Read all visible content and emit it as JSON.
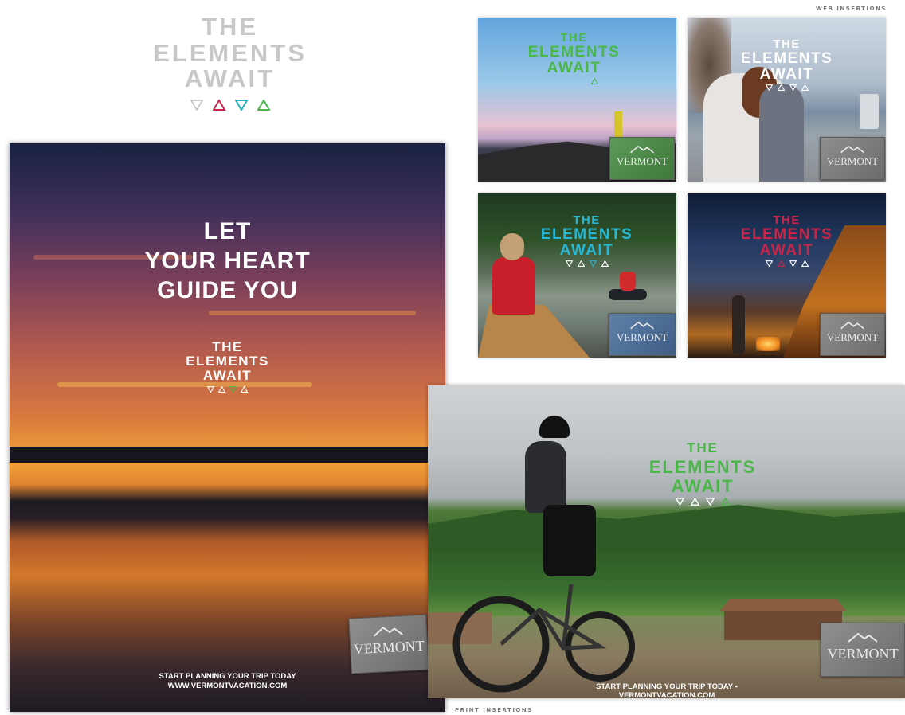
{
  "header_logo": {
    "lines": [
      "THE",
      "ELEMENTS",
      "AWAIT"
    ]
  },
  "captions": {
    "web": "WEB INSERTIONS",
    "print": "PRINT INSERTIONS"
  },
  "poster": {
    "headline": [
      "LET",
      "YOUR HEART",
      "GUIDE YOU"
    ],
    "logo": [
      "THE",
      "ELEMENTS",
      "AWAIT"
    ],
    "cta": [
      "START PLANNING YOUR TRIP TODAY",
      "WWW.VERMONTVACATION.COM"
    ],
    "tag": "VERMONT"
  },
  "tiles": [
    {
      "logo": [
        "THE",
        "ELEMENTS",
        "AWAIT"
      ],
      "tag": "VERMONT"
    },
    {
      "logo": [
        "THE",
        "ELEMENTS",
        "AWAIT"
      ],
      "tag": "VERMONT"
    },
    {
      "logo": [
        "THE",
        "ELEMENTS",
        "AWAIT"
      ],
      "tag": "VERMONT"
    },
    {
      "logo": [
        "THE",
        "ELEMENTS",
        "AWAIT"
      ],
      "tag": "VERMONT"
    }
  ],
  "bike_ad": {
    "logo": [
      "THE",
      "ELEMENTS",
      "AWAIT"
    ],
    "cta": "START PLANNING YOUR TRIP TODAY • VERMONTVACATION.COM",
    "tag": "VERMONT"
  },
  "colors": {
    "triangle_outline": "#ffffff",
    "triangle_red": "#c8254a",
    "triangle_teal": "#2ab0c0",
    "triangle_green": "#4ab848",
    "header_gray": "#c8c8c8",
    "tile1_green": "#4ab848",
    "tile3_cyan": "#27b8d6",
    "tile4_red": "#c8254a"
  }
}
